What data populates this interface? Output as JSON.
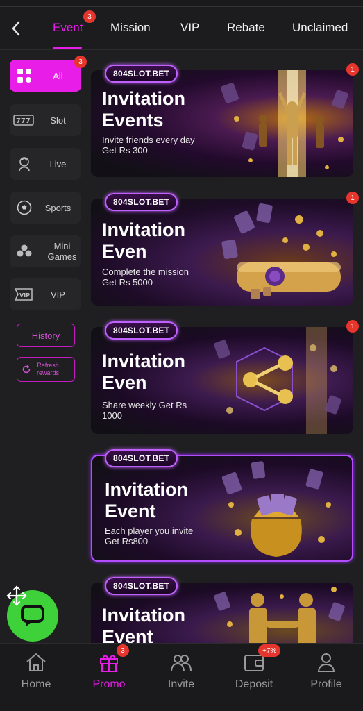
{
  "topnav": {
    "tabs": [
      {
        "label": "Event",
        "badge": "3",
        "active": true
      },
      {
        "label": "Mission"
      },
      {
        "label": "VIP"
      },
      {
        "label": "Rebate"
      },
      {
        "label": "Unclaimed"
      }
    ]
  },
  "sidebar": {
    "items": [
      {
        "label": "All",
        "badge": "3",
        "icon": "grid-icon",
        "active": true
      },
      {
        "label": "Slot",
        "icon": "slot-777-icon"
      },
      {
        "label": "Live",
        "icon": "live-dealer-icon"
      },
      {
        "label": "Sports",
        "icon": "soccer-ball-icon"
      },
      {
        "label": "Mini Games",
        "icon": "mini-games-icon"
      },
      {
        "label": "VIP",
        "icon": "vip-icon"
      }
    ],
    "history_label": "History",
    "refresh_label_1": "Refresh",
    "refresh_label_2": "rewards"
  },
  "promos": [
    {
      "logo": "804SLOT.BET",
      "title_1": "Invitation",
      "title_2": "Events",
      "sub_1": "Invite friends every day",
      "sub_2": "Get Rs 300",
      "badge": "1"
    },
    {
      "logo": "804SLOT.BET",
      "title_1": "Invitation",
      "title_2": "Even",
      "sub_1": "Complete the mission",
      "sub_2": "Get Rs 5000",
      "badge": "1"
    },
    {
      "logo": "804SLOT.BET",
      "title_1": "Invitation",
      "title_2": "Even",
      "sub_1": "Share weekly Get Rs",
      "sub_2": "1000",
      "badge": "1"
    },
    {
      "logo": "804SLOT.BET",
      "title_1": "Invitation",
      "title_2": "Event",
      "sub_1": "Each player you invite",
      "sub_2": "Get Rs800"
    },
    {
      "logo": "804SLOT.BET",
      "title_1": "Invitation",
      "title_2": "Event"
    }
  ],
  "bottomnav": {
    "items": [
      {
        "label": "Home",
        "icon": "home-icon"
      },
      {
        "label": "Promo",
        "icon": "gift-icon",
        "badge": "3",
        "active": true
      },
      {
        "label": "Invite",
        "icon": "people-icon"
      },
      {
        "label": "Deposit",
        "icon": "wallet-icon",
        "badge": "+7%"
      },
      {
        "label": "Profile",
        "icon": "person-icon"
      }
    ]
  },
  "colors": {
    "accent": "#e81ee8",
    "badge": "#e5352d",
    "chat": "#3fd13a"
  }
}
